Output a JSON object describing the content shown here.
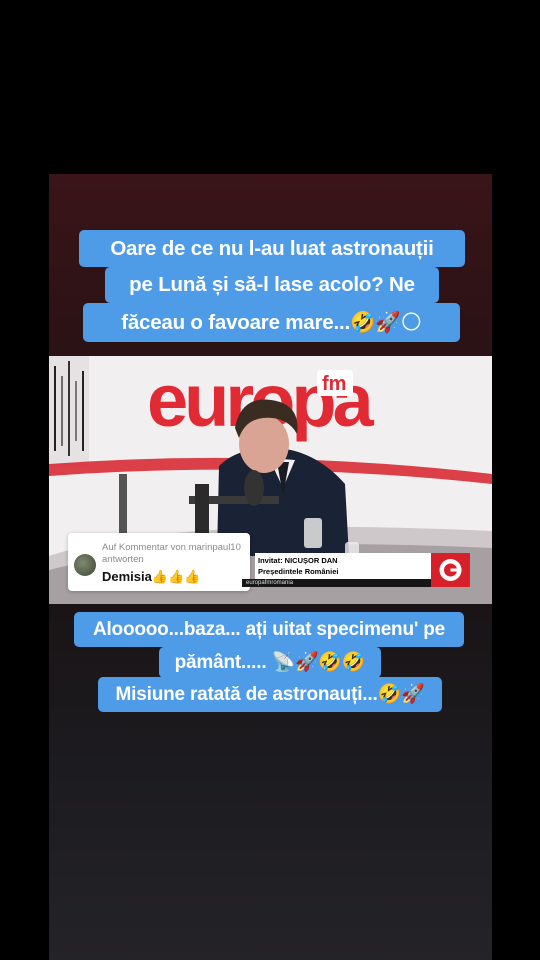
{
  "top_caption": {
    "line1": "Oare de ce nu l-au luat astronauții",
    "line2": "pe Lună și să-l lase acolo? Ne",
    "line3": "făceau o favoare mare...🤣🚀🌕"
  },
  "video": {
    "brand_text": "europa",
    "brand_sub": "fm",
    "lower_third": {
      "line1": "Invitat: NICUȘOR DAN",
      "line2": "Președintele României",
      "handle": "europafmromania"
    }
  },
  "reply_card": {
    "header": "Auf Kommentar von marinpaul10 antworten",
    "comment": "Demisia👍👍👍"
  },
  "bottom_caption": {
    "line1": "Alooooo...baza... ați uitat specimenu' pe",
    "line2": "pământ..... 📡🚀🤣🤣",
    "line3": "Misiune ratată de astronauți...🤣🚀"
  },
  "colors": {
    "caption_bg": "#4e9be8",
    "brand_red": "#d7202a"
  }
}
